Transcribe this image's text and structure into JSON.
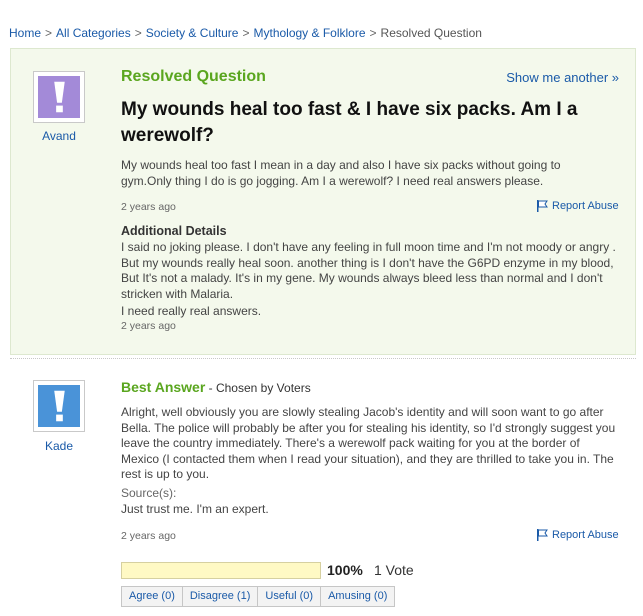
{
  "breadcrumb": {
    "items": [
      "Home",
      "All Categories",
      "Society & Culture",
      "Mythology & Folklore"
    ],
    "separator": ">",
    "current": "Resolved Question"
  },
  "question": {
    "section_label": "Resolved Question",
    "show_another": "Show me another »",
    "asker": "Avand",
    "title": "My wounds heal too fast & I have six packs. Am I a werewolf?",
    "body": "My wounds heal too fast I mean in a day and also I have six packs without going to gym.Only thing I do is go jogging. Am I a werewolf? I need real answers please.",
    "timestamp": "2 years ago",
    "report": "Report Abuse",
    "additional_heading": "Additional Details",
    "additional_body": "I said no joking please. I don't have any feeling in full moon time and I'm not moody or angry . But my wounds really heal soon. another thing is I don't have the G6PD enzyme in my blood, But It's not a malady. It's in my gene. My wounds always bleed less than normal and I don't stricken with Malaria.",
    "additional_body2": "I need really real answers.",
    "additional_timestamp": "2 years ago"
  },
  "answer": {
    "section_label": "Best Answer",
    "chosen_by": "- Chosen by Voters",
    "answerer": "Kade",
    "body": "Alright, well obviously you are slowly stealing Jacob's identity and will soon want to go after Bella. The police will probably be after you for stealing his identity, so I'd strongly suggest you leave the country immediately. There's a werewolf pack waiting for you at the border of Mexico (I contacted them when I read your situation), and they are thrilled to take you in. The rest is up to you.",
    "sources_label": "Source(s):",
    "sources_text": "Just trust me. I'm an expert.",
    "timestamp": "2 years ago",
    "report": "Report Abuse",
    "rating_fill": 1.0,
    "rating_percent": "100%",
    "rating_votes": "1 Vote",
    "vote_buttons": [
      "Agree (0)",
      "Disagree (1)",
      "Useful (0)",
      "Amusing (0)"
    ]
  },
  "colors": {
    "accent_green": "#5aa61f",
    "link_blue": "#1a5aa8",
    "avatar_purple": "#a38ad8",
    "avatar_blue": "#4a93d8"
  },
  "icons": {
    "avatar": "exclamation-avatar-icon",
    "report": "flag-icon"
  }
}
